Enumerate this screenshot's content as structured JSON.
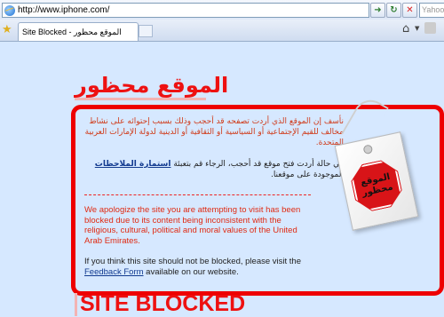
{
  "browser": {
    "url": "http://www.iphone.com/",
    "search_placeholder": "Yahoo",
    "tab_title": "Site Blocked - الموقع محظور"
  },
  "page": {
    "title_ar": "الموقع محظور",
    "arabic_paragraph_1": "نأسف إن الموقع الذي أردت تصفحه قد أحجب وذلك بسبب إحتوائه على نشاط مخالف للقيم الإجتماعية أو السياسية أو الثقافية أو الدينية لدولة الإمارات العربية المتحدة.",
    "arabic_paragraph_2_prefix": "في حالة أردت فتح موقع قد أحجب، الرجاء قم بتعبئة",
    "arabic_link": "استمارة الملاحظات",
    "arabic_paragraph_2_suffix": "الموجودة على موقعنا.",
    "english_paragraph_1": "We apologize the site you are attempting to visit has been blocked due to its content being inconsistent with the religious, cultural, political and moral values of the United Arab Emirates.",
    "english_paragraph_2_prefix": "If you think this site should not be blocked, please visit the",
    "english_link": "Feedback Form",
    "english_paragraph_2_suffix": "available on our website.",
    "stop_sign_line1": "الموقع",
    "stop_sign_line2": "محظور",
    "title_en": "SITE BLOCKED"
  },
  "colors": {
    "accent_red": "#e00000",
    "page_background": "#d6e8ff",
    "link_blue": "#123a8f"
  },
  "icons": [
    "ie-page-icon",
    "go-icon",
    "refresh-icon",
    "stop-icon",
    "favorites-star-icon",
    "home-icon",
    "feed-icon",
    "stop-sign-icon"
  ]
}
